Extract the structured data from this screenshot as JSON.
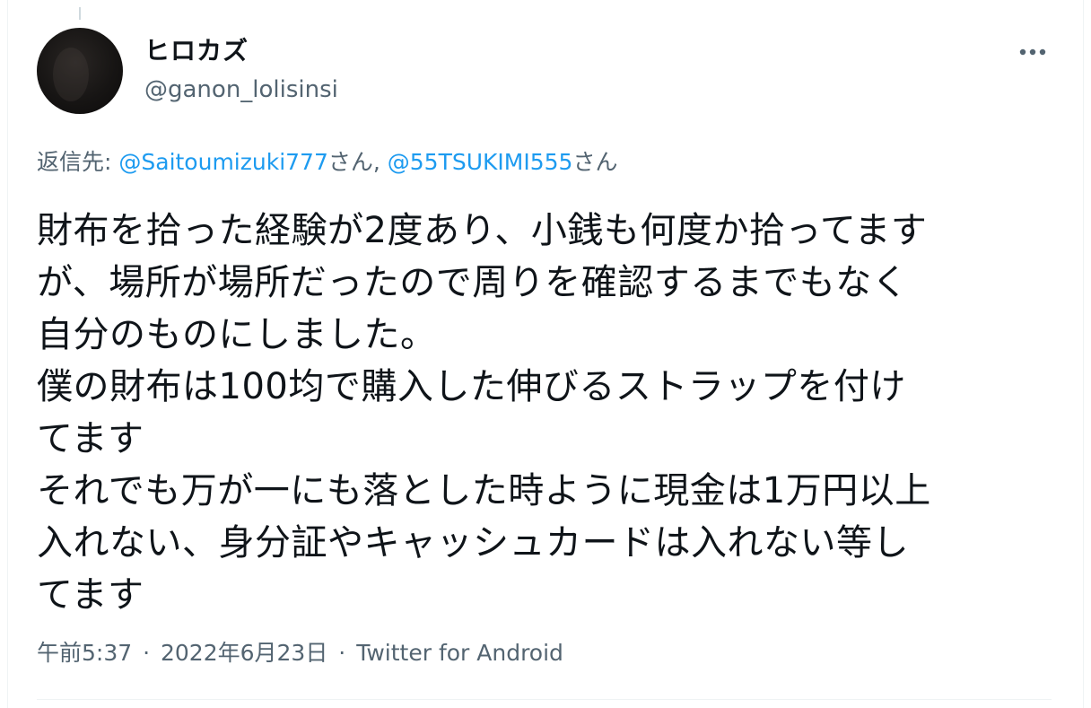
{
  "tweet": {
    "display_name": "ヒロカズ",
    "handle": "@ganon_lolisinsi",
    "reply_to": {
      "prefix": "返信先: ",
      "mentions": [
        {
          "handle": "@Saitoumizuki777",
          "suffix": "さん, "
        },
        {
          "handle": "@55TSUKIMI555",
          "suffix": "さん"
        }
      ]
    },
    "text_lines": [
      "財布を拾った経験が2度あり、小銭も何度か拾ってます",
      "が、場所が場所だったので周りを確認するまでもなく",
      "自分のものにしました。",
      "僕の財布は100均で購入した伸びるストラップを付け",
      "てます",
      "それでも万が一にも落とした時ように現金は1万円以上",
      "入れない、身分証やキャッシュカードは入れない等し",
      "てます"
    ],
    "meta": {
      "time": "午前5:37",
      "separator": "·",
      "date": "2022年6月23日",
      "source": "Twitter for Android"
    },
    "icons": {
      "more": "more-horizontal-icon",
      "avatar": "profile-avatar"
    }
  },
  "colors": {
    "text_primary": "#0f1419",
    "text_secondary": "#536471",
    "link": "#1d9bf0",
    "border": "#eff3f4"
  }
}
